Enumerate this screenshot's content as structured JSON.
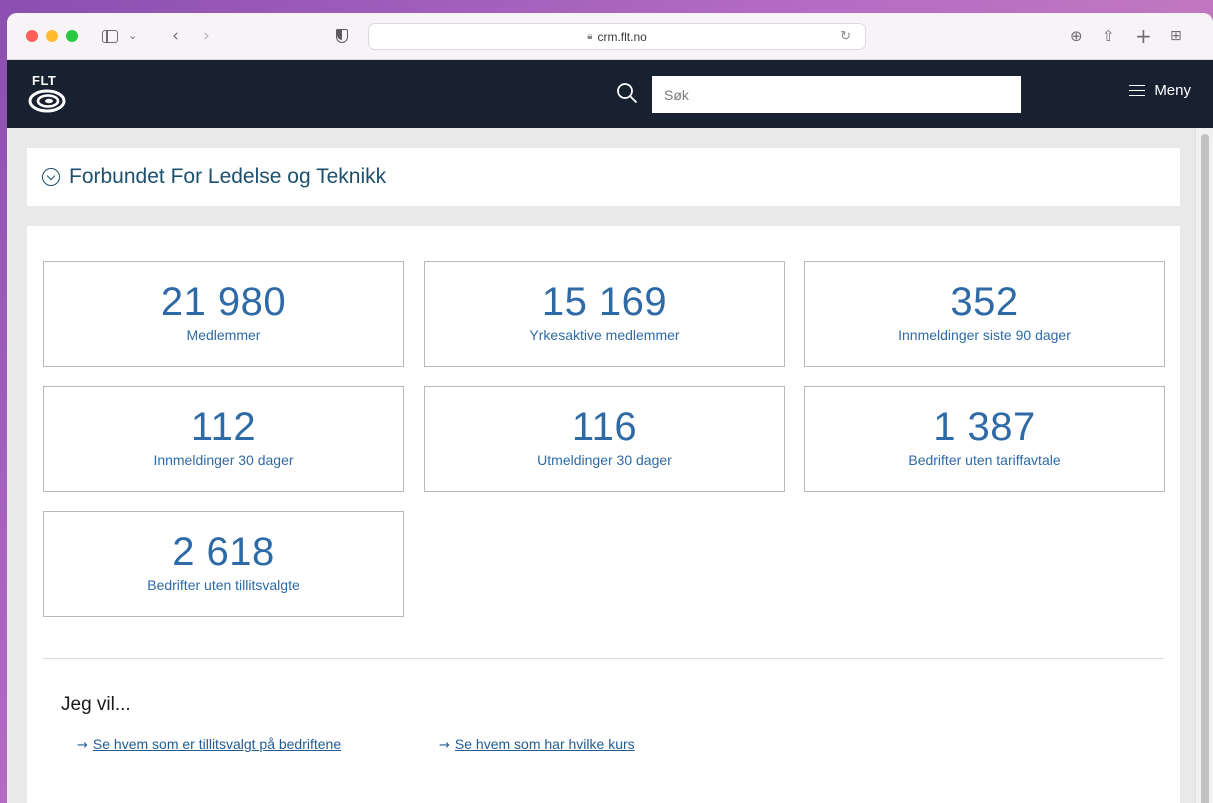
{
  "browser": {
    "url": "crm.flt.no",
    "icons": [
      "sidebar-icon",
      "chevron-down-icon",
      "back-icon",
      "forward-icon",
      "shield-icon",
      "lock-icon",
      "reload-icon",
      "download-icon",
      "share-icon",
      "new-tab-icon",
      "tab-overview-icon"
    ]
  },
  "header": {
    "logo_text": "FLT",
    "search_placeholder": "Søk",
    "menu_label": "Meny"
  },
  "org": {
    "title": "Forbundet For Ledelse og Teknikk"
  },
  "stats": [
    {
      "value": "21 980",
      "label": "Medlemmer"
    },
    {
      "value": "15 169",
      "label": "Yrkesaktive medlemmer"
    },
    {
      "value": "352",
      "label": "Innmeldinger siste 90 dager"
    },
    {
      "value": "112",
      "label": "Innmeldinger 30 dager"
    },
    {
      "value": "116",
      "label": "Utmeldinger 30 dager"
    },
    {
      "value": "1 387",
      "label": "Bedrifter uten tariffavtale"
    },
    {
      "value": "2 618",
      "label": "Bedrifter uten tillitsvalgte"
    }
  ],
  "actions": {
    "heading": "Jeg vil...",
    "links": [
      {
        "label": "Se hvem som er tillitsvalgt på bedriftene"
      },
      {
        "label": "Se hvem som har hvilke kurs"
      }
    ]
  },
  "colors": {
    "header_bg": "#182130",
    "accent": "#2e6aa6",
    "title": "#1d4f6e"
  }
}
